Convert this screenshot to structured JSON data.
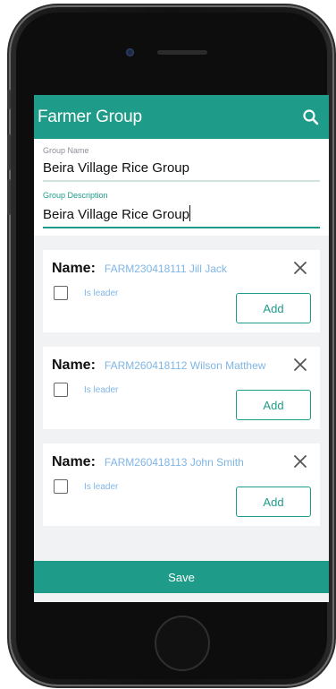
{
  "appbar": {
    "title": "Farmer Group",
    "search_icon": "search-icon"
  },
  "form": {
    "group_name_label": "Group Name",
    "group_name_value": "Beira Village Rice Group",
    "group_description_label": "Group Description",
    "group_description_value": "Beira Village Rice Group"
  },
  "members": [
    {
      "name_label": "Name:",
      "name_value": "FARM230418111 Jill Jack",
      "leader_label": "Is leader",
      "add_label": "Add"
    },
    {
      "name_label": "Name:",
      "name_value": "FARM260418112 Wilson Matthew",
      "leader_label": "Is leader",
      "add_label": "Add"
    },
    {
      "name_label": "Name:",
      "name_value": "FARM260418113 John Smith",
      "leader_label": "Is leader",
      "add_label": "Add"
    }
  ],
  "save_label": "Save",
  "colors": {
    "primary": "#1f9c89",
    "link": "#7fb6e6"
  }
}
